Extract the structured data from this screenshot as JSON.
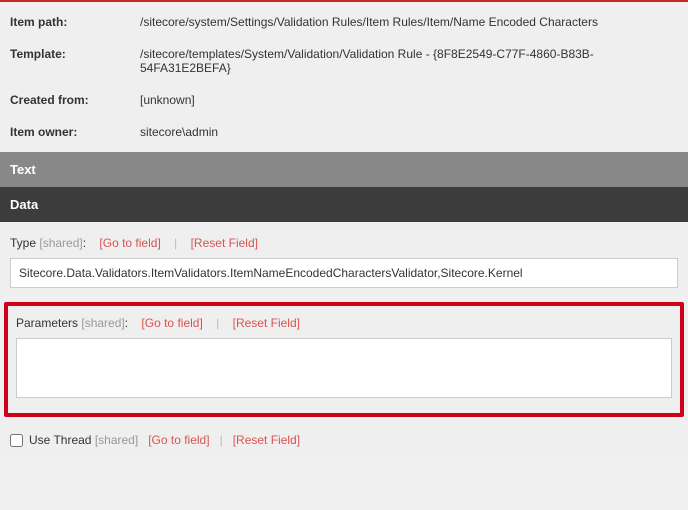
{
  "info": {
    "itemPath": {
      "label": "Item path:",
      "value": "/sitecore/system/Settings/Validation Rules/Item Rules/Item/Name Encoded Characters"
    },
    "template": {
      "label": "Template:",
      "value": "/sitecore/templates/System/Validation/Validation Rule - {8F8E2549-C77F-4860-B83B-54FA31E2BEFA}"
    },
    "createdFrom": {
      "label": "Created from:",
      "value": "[unknown]"
    },
    "itemOwner": {
      "label": "Item owner:",
      "value": "sitecore\\admin"
    }
  },
  "sections": {
    "text": "Text",
    "data": "Data"
  },
  "fields": {
    "type": {
      "label": "Type",
      "shared": "[shared]",
      "colon": ":",
      "goTo": "[Go to field]",
      "reset": "[Reset Field]",
      "value": "Sitecore.Data.Validators.ItemValidators.ItemNameEncodedCharactersValidator,Sitecore.Kernel"
    },
    "parameters": {
      "label": "Parameters",
      "shared": "[shared]",
      "colon": ":",
      "goTo": "[Go to field]",
      "reset": "[Reset Field]",
      "value": ""
    },
    "useThread": {
      "label": "Use Thread",
      "shared": "[shared]",
      "goTo": "[Go to field]",
      "reset": "[Reset Field]"
    }
  },
  "sep": "|"
}
